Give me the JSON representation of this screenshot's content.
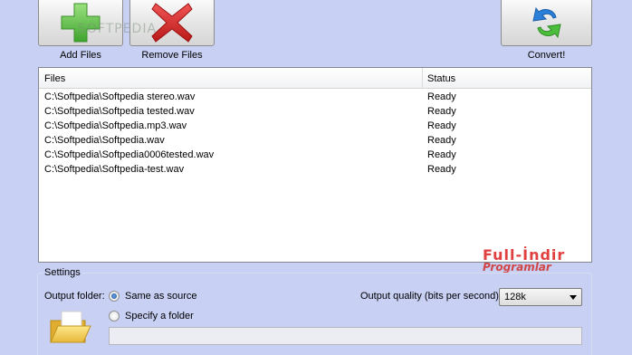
{
  "toolbar": {
    "add_files_label": "Add Files",
    "remove_files_label": "Remove Files",
    "convert_label": "Convert!"
  },
  "file_list": {
    "columns": [
      "Files",
      "Status"
    ],
    "rows": [
      {
        "file": "C:\\Softpedia\\Softpedia stereo.wav",
        "status": "Ready"
      },
      {
        "file": "C:\\Softpedia\\Softpedia tested.wav",
        "status": "Ready"
      },
      {
        "file": "C:\\Softpedia\\Softpedia.mp3.wav",
        "status": "Ready"
      },
      {
        "file": "C:\\Softpedia\\Softpedia.wav",
        "status": "Ready"
      },
      {
        "file": "C:\\Softpedia\\Softpedia0006tested.wav",
        "status": "Ready"
      },
      {
        "file": "C:\\Softpedia\\Softpedia-test.wav",
        "status": "Ready"
      }
    ]
  },
  "settings": {
    "title": "Settings",
    "output_folder_label": "Output folder:",
    "same_as_source_label": "Same as source",
    "specify_folder_label": "Specify a folder",
    "selected_option": "Same as source",
    "folder_value": "",
    "output_quality_label": "Output quality (bits per second):",
    "output_quality_value": "128k"
  },
  "watermarks": {
    "line1": "Full-İndir",
    "line2": "Programlar",
    "softpedia": "SOFTPEDIA"
  },
  "icons": {
    "add": "plus-icon",
    "remove": "x-icon",
    "convert": "convert-arrows-icon",
    "folder": "folder-icon",
    "dropdown": "chevron-down-icon"
  },
  "colors": {
    "background": "#c8d0f4",
    "add_icon": "#5cc24a",
    "remove_icon": "#d42a2a",
    "convert_arrow_blue": "#2b7fd8",
    "convert_arrow_green": "#4bbf3b"
  }
}
